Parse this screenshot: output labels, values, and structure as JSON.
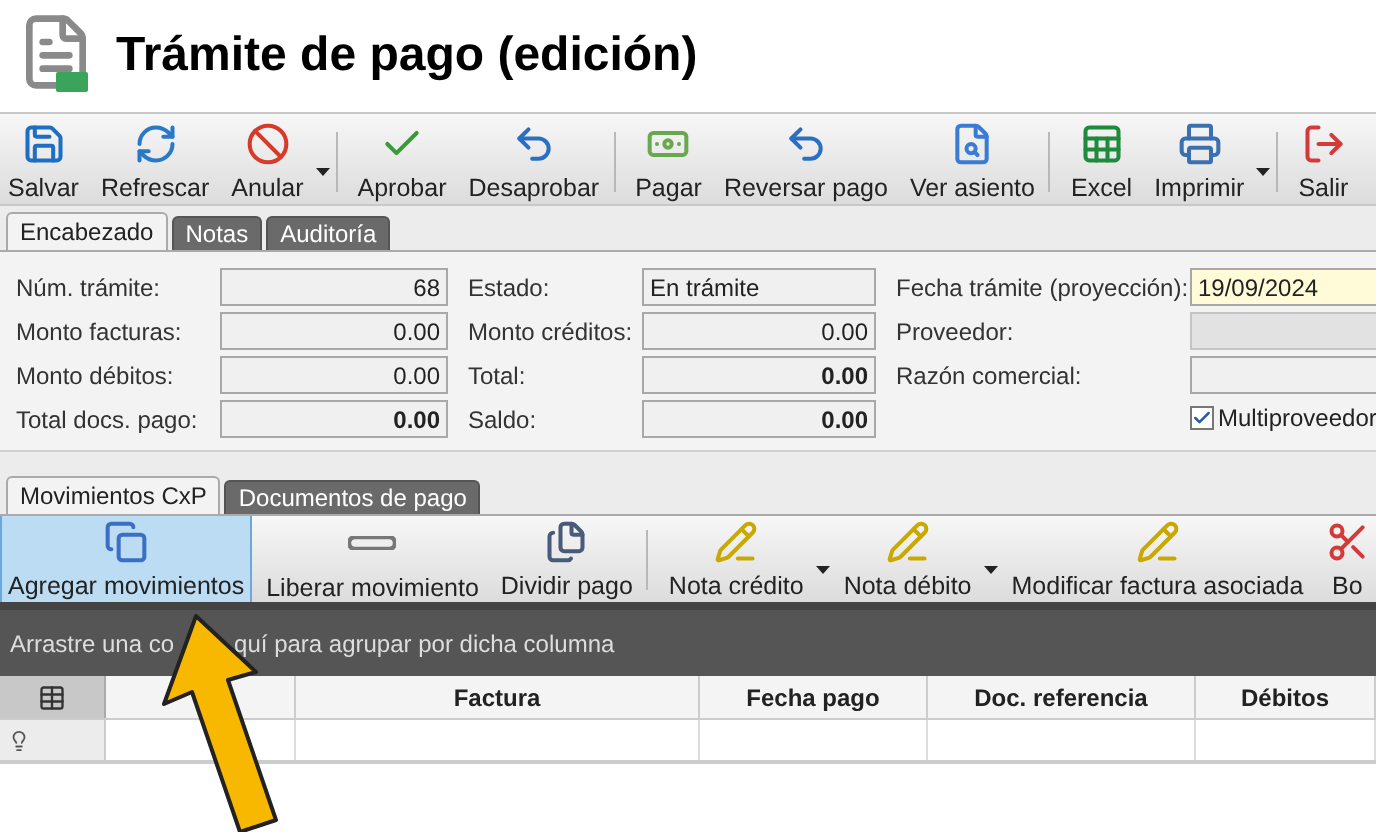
{
  "window": {
    "title": "Trámite de pago (edición)"
  },
  "toolbar": [
    {
      "label": "Salvar",
      "dropdown": false,
      "separator_before": false
    },
    {
      "label": "Refrescar",
      "dropdown": false,
      "separator_before": false
    },
    {
      "label": "Anular",
      "dropdown": true,
      "separator_before": false
    },
    {
      "label": "Aprobar",
      "dropdown": false,
      "separator_before": true
    },
    {
      "label": "Desaprobar",
      "dropdown": false,
      "separator_before": false
    },
    {
      "label": "Pagar",
      "dropdown": false,
      "separator_before": true
    },
    {
      "label": "Reversar pago",
      "dropdown": false,
      "separator_before": false
    },
    {
      "label": "Ver asiento",
      "dropdown": false,
      "separator_before": false
    },
    {
      "label": "Excel",
      "dropdown": false,
      "separator_before": true
    },
    {
      "label": "Imprimir",
      "dropdown": true,
      "separator_before": false
    },
    {
      "label": "Salir",
      "dropdown": false,
      "separator_before": true
    }
  ],
  "header_tabs": [
    {
      "label": "Encabezado",
      "selected": true
    },
    {
      "label": "Notas",
      "selected": false
    },
    {
      "label": "Auditoría",
      "selected": false
    }
  ],
  "form": {
    "columns": [
      [
        {
          "label": "Núm. trámite:",
          "value": "68",
          "kind": "number",
          "bold": false
        },
        {
          "label": "Monto facturas:",
          "value": "0.00",
          "kind": "number",
          "bold": false
        },
        {
          "label": "Monto débitos:",
          "value": "0.00",
          "kind": "number",
          "bold": false
        },
        {
          "label": "Total docs. pago:",
          "value": "0.00",
          "kind": "number",
          "bold": true
        }
      ],
      [
        {
          "label": "Estado:",
          "value": "En trámite",
          "kind": "text",
          "bold": false
        },
        {
          "label": "Monto créditos:",
          "value": "0.00",
          "kind": "number",
          "bold": false
        },
        {
          "label": "Total:",
          "value": "0.00",
          "kind": "number",
          "bold": true
        },
        {
          "label": "Saldo:",
          "value": "0.00",
          "kind": "number",
          "bold": true
        }
      ],
      [
        {
          "label": "Fecha trámite (proyección):",
          "value": "19/09/2024",
          "kind": "date",
          "bold": false
        },
        {
          "label": "Proveedor:",
          "kind": "combo",
          "disabled": true
        },
        {
          "label": "Razón comercial:",
          "kind": "text"
        }
      ]
    ],
    "checkbox": {
      "label": "Multiproveedor",
      "checked": true
    }
  },
  "detail_tabs": [
    {
      "label": "Movimientos CxP",
      "selected": true
    },
    {
      "label": "Documentos de pago",
      "selected": false
    }
  ],
  "detail_toolbar": [
    {
      "label": "Agregar movimientos",
      "selected": true,
      "dropdown": false,
      "separator_before": false
    },
    {
      "label": "Liberar movimiento",
      "selected": false,
      "dropdown": false,
      "separator_before": false
    },
    {
      "label": "Dividir pago",
      "selected": false,
      "dropdown": false,
      "separator_before": false
    },
    {
      "label": "Nota crédito",
      "selected": false,
      "dropdown": true,
      "separator_before": true
    },
    {
      "label": "Nota débito",
      "selected": false,
      "dropdown": true,
      "separator_before": false
    },
    {
      "label": "Modificar factura asociada",
      "selected": false,
      "dropdown": false,
      "separator_before": false
    },
    {
      "label": "Bo",
      "selected": false,
      "dropdown": false,
      "separator_before": false
    }
  ],
  "group_panel": [
    "Arrastre una co",
    "quí para agrupar por dicha columna"
  ],
  "table": {
    "columns": [
      "Factura",
      "Fecha pago",
      "Doc. referencia",
      "Débitos"
    ]
  }
}
